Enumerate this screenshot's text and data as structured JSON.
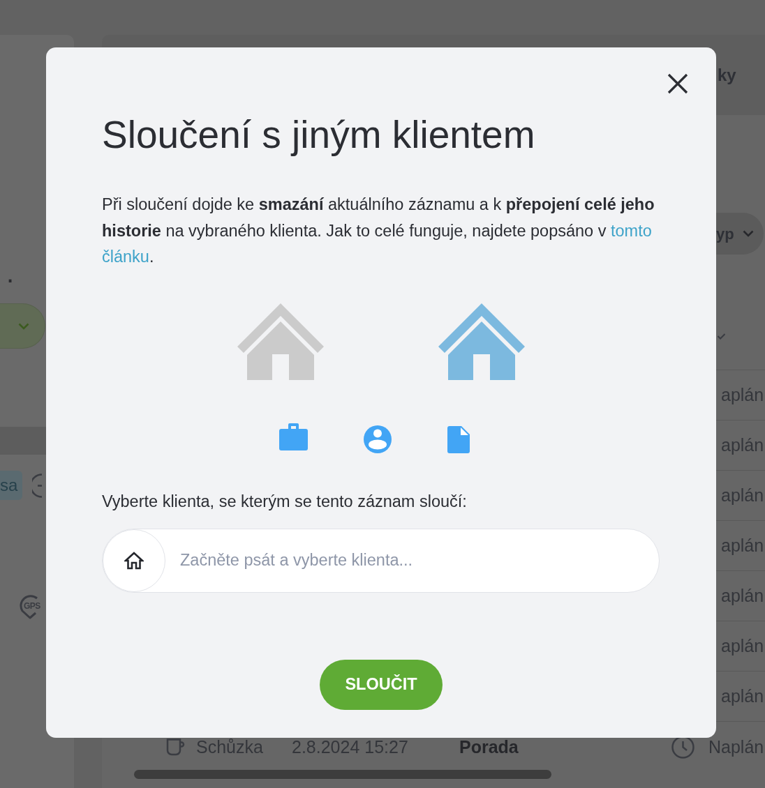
{
  "app_background": {
    "left_panel": {
      "heading_fragment": ".",
      "tag": "sa",
      "gps_label": "GPS"
    },
    "main_panel": {
      "header_fragment": "ky",
      "filter_dropdown": "yp",
      "rows": [
        {
          "column_4": "aplán"
        },
        {
          "column_4": "aplán"
        },
        {
          "column_4": "aplán"
        },
        {
          "column_4": "aplán"
        },
        {
          "column_4": "aplán"
        },
        {
          "column_4": "aplán"
        },
        {
          "column_4": "aplán"
        },
        {
          "column_1": "Schůzka",
          "column_2": "2.8.2024 15:27",
          "column_3": "Porada",
          "column_4": "Naplán"
        }
      ]
    }
  },
  "dialog": {
    "title": "Sloučení s jiným klientem",
    "description": {
      "text": "Při sloučení dojde ke **smazání** aktuálního záznamu a k **přepojení celé jeho historie** na vybraného klienta. Jak to celé funguje, najdete popsáno v",
      "link": "tomto článku",
      "after": "."
    },
    "select_label": "Vyberte klienta, se kterým se tento záznam sloučí:",
    "client_field": {
      "placeholder": "Začněte psát a vyberte klienta..."
    },
    "submit_button": "SLOUČIT"
  }
}
